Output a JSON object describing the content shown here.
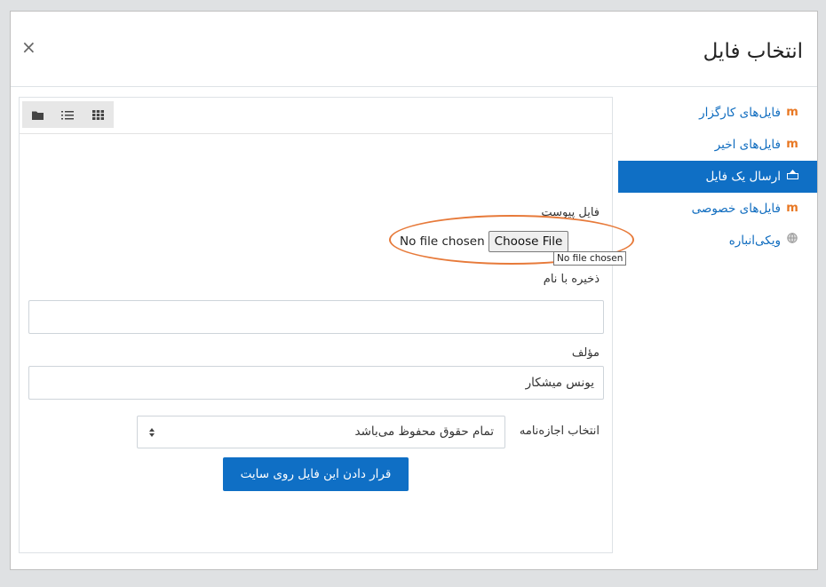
{
  "dialog": {
    "title": "انتخاب فایل",
    "close_glyph": "×"
  },
  "repositories": [
    {
      "label": "فایل‌های کارگزار",
      "icon": "moodle-m-icon",
      "active": false
    },
    {
      "label": "فایل‌های اخیر",
      "icon": "moodle-m-icon",
      "active": false
    },
    {
      "label": "ارسال یک فایل",
      "icon": "upload-icon",
      "active": true
    },
    {
      "label": "فایل‌های خصوصی",
      "icon": "moodle-m-icon",
      "active": false
    },
    {
      "label": "ویکی‌انباره",
      "icon": "wikimedia-globe-icon",
      "active": false
    }
  ],
  "view_modes": [
    "folder-icon",
    "list-icon",
    "grid-icon"
  ],
  "upload_form": {
    "attachment_label": "فایل پیوست",
    "file_status": "No file chosen",
    "choose_file_button": "Choose File",
    "tooltip": "No file chosen",
    "save_as_label": "ذخیره با نام",
    "save_as_value": "",
    "author_label": "مؤلف",
    "author_value": "یونس میشکار",
    "license_label": "انتخاب اجازه‌نامه",
    "license_value": "تمام حقوق محفوظ می‌باشد",
    "submit_button": "قرار دادن این فایل روی سایت"
  },
  "colors": {
    "primary": "#0f6fc5",
    "link": "#0f6cbf",
    "annotation": "#e77a3a"
  }
}
